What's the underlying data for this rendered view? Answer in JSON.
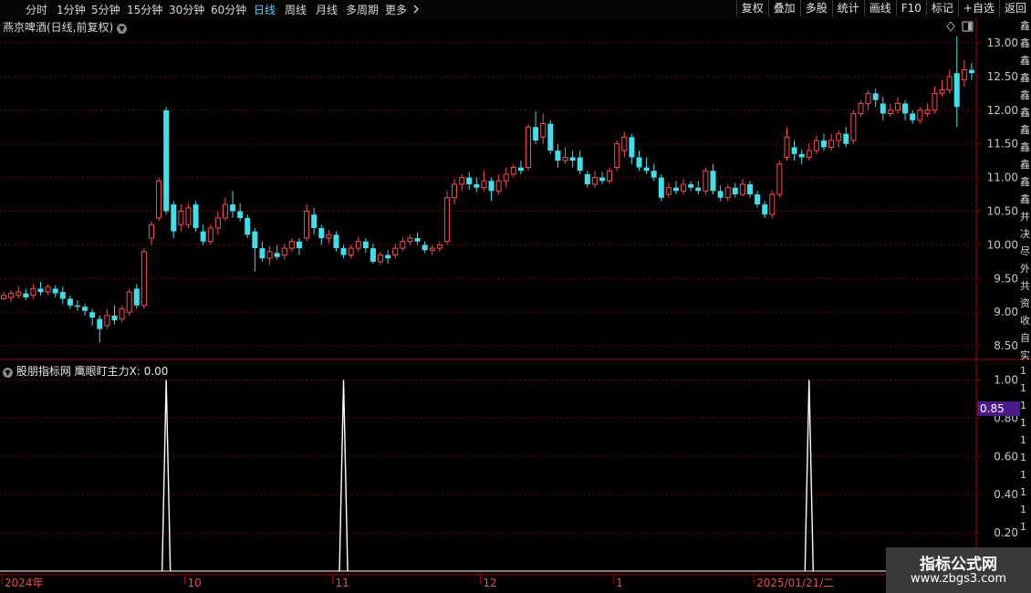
{
  "toolbar": {
    "periods": [
      "分时",
      "1分钟",
      "5分钟",
      "15分钟",
      "30分钟",
      "60分钟",
      "日线",
      "周线",
      "月线",
      "多周期",
      "更多"
    ],
    "active_period": "日线",
    "more_icon": "chevron-right-icon",
    "buttons": [
      "复权",
      "叠加",
      "多股",
      "统计",
      "画线",
      "F10",
      "标记",
      "+自选",
      "返回"
    ]
  },
  "main_chart": {
    "title": "燕京啤酒(日线,前复权)",
    "title_icon": "chevron-down-icon",
    "corner_icons": [
      "diamond-icon",
      "window-icon"
    ]
  },
  "indicator": {
    "title": "股朋指标网 鹰眼盯主力X: 0.00",
    "title_icon": "chevron-down-icon",
    "cursor_value": "0.85"
  },
  "watermark": {
    "line1": "指标公式网",
    "line2": "www.zbgs3.com"
  },
  "side_strip": [
    "鑫",
    "鑫",
    "鑫",
    "鑫",
    "鑫",
    "鑫",
    "鑫",
    "鑫",
    "鑫",
    "鑫",
    "鑫",
    "并",
    "决",
    "尽",
    "外",
    "共",
    "资",
    "收",
    "自",
    "实",
    "1",
    "1",
    "1",
    "1",
    "1",
    "1",
    "1",
    "1",
    "1",
    "1"
  ],
  "colors": {
    "up": "#ff4a4a",
    "down": "#3fe0ea",
    "grid": "#7a0000",
    "axis_border": "#a00000",
    "text": "#c8c8c8",
    "cursor_tag": "#4a1a8c",
    "ma": "#e6c84b"
  },
  "chart_data": [
    {
      "type": "candlestick",
      "title": "燕京啤酒(日线,前复权)",
      "y_ticks": [
        8.5,
        9.0,
        9.5,
        10.0,
        10.5,
        11.0,
        11.5,
        12.0,
        12.5,
        13.0
      ],
      "y_tick_labels": [
        "8.50",
        "9.00",
        "9.50",
        "10.00",
        "10.50",
        "11.00",
        "11.50",
        "12.00",
        "12.50",
        "13.00"
      ],
      "ylim": [
        8.3,
        13.1
      ],
      "x_labels": [
        "2024年",
        "10",
        "11",
        "12",
        "1",
        "2025/01/21/二",
        "3"
      ],
      "x_label_index": [
        0,
        25,
        45,
        65,
        83,
        102,
        126
      ],
      "cursor_index": 110,
      "candles": [
        [
          9.2,
          9.25,
          9.3,
          9.18
        ],
        [
          9.22,
          9.28,
          9.33,
          9.15
        ],
        [
          9.25,
          9.3,
          9.38,
          9.2
        ],
        [
          9.28,
          9.22,
          9.35,
          9.18
        ],
        [
          9.25,
          9.35,
          9.42,
          9.2
        ],
        [
          9.35,
          9.3,
          9.45,
          9.25
        ],
        [
          9.3,
          9.38,
          9.42,
          9.25
        ],
        [
          9.35,
          9.28,
          9.4,
          9.22
        ],
        [
          9.3,
          9.2,
          9.38,
          9.12
        ],
        [
          9.2,
          9.1,
          9.25,
          9.05
        ],
        [
          9.1,
          9.08,
          9.18,
          9.02
        ],
        [
          9.08,
          9.02,
          9.12,
          8.95
        ],
        [
          9.0,
          8.92,
          9.05,
          8.8
        ],
        [
          8.9,
          8.75,
          8.95,
          8.55
        ],
        [
          8.8,
          8.95,
          9.05,
          8.75
        ],
        [
          8.95,
          8.88,
          9.1,
          8.82
        ],
        [
          8.9,
          9.05,
          9.1,
          8.85
        ],
        [
          9.0,
          9.3,
          9.35,
          8.95
        ],
        [
          9.35,
          9.1,
          9.42,
          9.05
        ],
        [
          9.1,
          9.9,
          9.95,
          9.05
        ],
        [
          10.1,
          10.3,
          10.35,
          10.0
        ],
        [
          10.4,
          10.95,
          11.0,
          10.35
        ],
        [
          12.0,
          10.5,
          12.05,
          10.45
        ],
        [
          10.6,
          10.2,
          10.65,
          10.1
        ],
        [
          10.3,
          10.5,
          10.6,
          10.2
        ],
        [
          10.3,
          10.55,
          10.62,
          10.25
        ],
        [
          10.6,
          10.25,
          10.65,
          10.2
        ],
        [
          10.2,
          10.05,
          10.3,
          10.0
        ],
        [
          10.05,
          10.25,
          10.3,
          10.0
        ],
        [
          10.25,
          10.4,
          10.5,
          10.15
        ],
        [
          10.4,
          10.6,
          10.7,
          10.35
        ],
        [
          10.6,
          10.5,
          10.8,
          10.4
        ],
        [
          10.5,
          10.4,
          10.62,
          10.35
        ],
        [
          10.4,
          10.15,
          10.45,
          10.1
        ],
        [
          10.2,
          9.95,
          10.25,
          9.6
        ],
        [
          9.95,
          9.8,
          10.05,
          9.75
        ],
        [
          9.8,
          9.9,
          9.98,
          9.7
        ],
        [
          9.88,
          9.82,
          10.0,
          9.78
        ],
        [
          9.85,
          9.95,
          10.02,
          9.78
        ],
        [
          9.95,
          10.05,
          10.1,
          9.9
        ],
        [
          10.05,
          9.95,
          10.1,
          9.85
        ],
        [
          10.1,
          10.5,
          10.6,
          10.05
        ],
        [
          10.45,
          10.25,
          10.55,
          10.15
        ],
        [
          10.25,
          10.1,
          10.3,
          10.0
        ],
        [
          10.1,
          10.15,
          10.22,
          10.02
        ],
        [
          10.15,
          9.95,
          10.2,
          9.9
        ],
        [
          9.95,
          9.85,
          10.0,
          9.8
        ],
        [
          9.85,
          9.95,
          10.0,
          9.8
        ],
        [
          9.95,
          10.05,
          10.12,
          9.9
        ],
        [
          10.05,
          9.95,
          10.1,
          9.88
        ],
        [
          9.95,
          9.75,
          10.02,
          9.72
        ],
        [
          9.75,
          9.85,
          9.9,
          9.7
        ],
        [
          9.85,
          9.8,
          9.92,
          9.72
        ],
        [
          9.85,
          9.95,
          10.02,
          9.8
        ],
        [
          9.95,
          10.05,
          10.12,
          9.9
        ],
        [
          10.05,
          10.1,
          10.15,
          10.0
        ],
        [
          10.1,
          10.05,
          10.18,
          10.0
        ],
        [
          10.0,
          9.92,
          10.05,
          9.88
        ],
        [
          9.92,
          9.95,
          10.0,
          9.85
        ],
        [
          9.95,
          10.0,
          10.05,
          9.9
        ],
        [
          10.05,
          10.7,
          10.8,
          10.0
        ],
        [
          10.7,
          10.9,
          10.98,
          10.6
        ],
        [
          10.9,
          11.0,
          11.05,
          10.8
        ],
        [
          11.0,
          10.9,
          11.08,
          10.82
        ],
        [
          10.9,
          10.85,
          11.0,
          10.78
        ],
        [
          10.85,
          10.95,
          11.1,
          10.8
        ],
        [
          10.95,
          10.8,
          11.0,
          10.65
        ],
        [
          10.8,
          10.95,
          11.05,
          10.75
        ],
        [
          10.95,
          11.05,
          11.15,
          10.85
        ],
        [
          11.05,
          11.15,
          11.2,
          11.0
        ],
        [
          11.15,
          11.1,
          11.25,
          11.05
        ],
        [
          11.15,
          11.75,
          11.8,
          11.1
        ],
        [
          11.75,
          11.55,
          11.98,
          11.5
        ],
        [
          11.6,
          11.8,
          11.95,
          11.5
        ],
        [
          11.8,
          11.4,
          11.85,
          11.35
        ],
        [
          11.4,
          11.25,
          11.5,
          11.15
        ],
        [
          11.25,
          11.3,
          11.45,
          11.2
        ],
        [
          11.3,
          11.25,
          11.4,
          11.15
        ],
        [
          11.3,
          11.1,
          11.4,
          11.05
        ],
        [
          11.05,
          10.9,
          11.1,
          10.85
        ],
        [
          10.9,
          11.0,
          11.1,
          10.85
        ],
        [
          11.0,
          10.95,
          11.08,
          10.9
        ],
        [
          10.95,
          11.1,
          11.15,
          10.9
        ],
        [
          11.15,
          11.5,
          11.55,
          11.1
        ],
        [
          11.4,
          11.6,
          11.68,
          11.3
        ],
        [
          11.6,
          11.3,
          11.65,
          11.2
        ],
        [
          11.3,
          11.15,
          11.4,
          11.1
        ],
        [
          11.15,
          11.1,
          11.3,
          11.05
        ],
        [
          11.1,
          11.0,
          11.2,
          10.95
        ],
        [
          11.0,
          10.7,
          11.05,
          10.65
        ],
        [
          10.75,
          10.85,
          10.92,
          10.7
        ],
        [
          10.85,
          10.8,
          10.95,
          10.75
        ],
        [
          10.8,
          10.9,
          10.98,
          10.75
        ],
        [
          10.9,
          10.85,
          10.95,
          10.8
        ],
        [
          10.85,
          10.8,
          10.95,
          10.75
        ],
        [
          10.8,
          11.1,
          11.15,
          10.75
        ],
        [
          11.1,
          10.8,
          11.2,
          10.75
        ],
        [
          10.8,
          10.7,
          10.88,
          10.65
        ],
        [
          10.7,
          10.85,
          10.9,
          10.65
        ],
        [
          10.85,
          10.75,
          10.92,
          10.7
        ],
        [
          10.75,
          10.9,
          10.98,
          10.72
        ],
        [
          10.9,
          10.75,
          10.95,
          10.7
        ],
        [
          10.75,
          10.6,
          10.8,
          10.55
        ],
        [
          10.6,
          10.45,
          10.65,
          10.4
        ],
        [
          10.45,
          10.75,
          10.8,
          10.4
        ],
        [
          10.75,
          11.2,
          11.25,
          10.7
        ],
        [
          11.3,
          11.6,
          11.75,
          11.25
        ],
        [
          11.45,
          11.35,
          11.55,
          11.25
        ],
        [
          11.35,
          11.3,
          11.42,
          11.2
        ],
        [
          11.3,
          11.4,
          11.5,
          11.25
        ],
        [
          11.4,
          11.55,
          11.62,
          11.35
        ],
        [
          11.55,
          11.45,
          11.65,
          11.4
        ],
        [
          11.45,
          11.55,
          11.65,
          11.4
        ],
        [
          11.55,
          11.65,
          11.7,
          11.45
        ],
        [
          11.65,
          11.5,
          11.75,
          11.45
        ],
        [
          11.55,
          11.95,
          12.0,
          11.5
        ],
        [
          11.95,
          12.1,
          12.15,
          11.9
        ],
        [
          12.1,
          12.25,
          12.3,
          12.0
        ],
        [
          12.25,
          12.15,
          12.32,
          12.05
        ],
        [
          12.1,
          11.95,
          12.2,
          11.85
        ],
        [
          11.95,
          12.0,
          12.1,
          11.9
        ],
        [
          12.0,
          12.1,
          12.2,
          11.95
        ],
        [
          12.1,
          11.95,
          12.15,
          11.85
        ],
        [
          11.95,
          11.85,
          12.0,
          11.8
        ],
        [
          11.85,
          12.0,
          12.05,
          11.8
        ],
        [
          11.95,
          12.0,
          12.1,
          11.9
        ],
        [
          12.0,
          12.25,
          12.35,
          11.95
        ],
        [
          12.25,
          12.3,
          12.45,
          12.2
        ],
        [
          12.3,
          12.5,
          12.6,
          12.25
        ],
        [
          12.55,
          12.05,
          13.1,
          11.75
        ],
        [
          12.45,
          12.6,
          12.75,
          12.35
        ],
        [
          12.6,
          12.55,
          12.7,
          12.45
        ]
      ]
    },
    {
      "type": "line",
      "series": [
        {
          "name": "鹰眼盯主力X",
          "peaks_at_index": [
            22,
            46,
            109
          ],
          "peak_value": 1.0,
          "base_value": 0.0
        }
      ],
      "y_ticks": [
        0.2,
        0.4,
        0.6,
        0.8,
        1.0
      ],
      "y_tick_labels": [
        "0.20",
        "0.40",
        "0.60",
        "0.80",
        "1.00"
      ],
      "ylim": [
        0.0,
        1.05
      ]
    }
  ]
}
